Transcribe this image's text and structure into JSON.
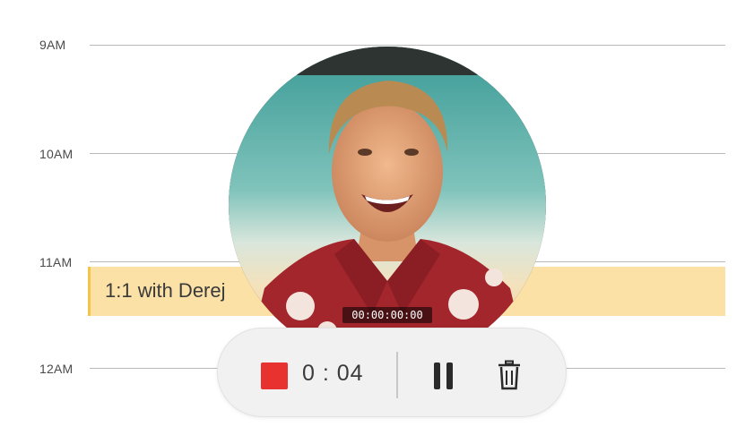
{
  "calendar": {
    "hours": [
      "9AM",
      "10AM",
      "11AM",
      "12AM"
    ],
    "event": {
      "title": "1:1 with Derej"
    }
  },
  "video": {
    "timecode": "00:00:00:00"
  },
  "recorder": {
    "elapsed": "0 : 04",
    "stop_color": "#e7322f",
    "stop_icon": "stop-square-icon",
    "pause_icon": "pause-icon",
    "delete_icon": "trash-icon"
  }
}
